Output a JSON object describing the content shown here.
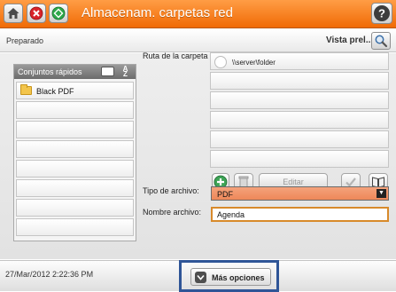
{
  "header": {
    "title": "Almacenam. carpetas red",
    "icons": {
      "home": "home-icon",
      "stop": "stop-icon",
      "start": "start-icon",
      "help": "help-icon"
    },
    "accent_color": "#f07a1a"
  },
  "status": {
    "text": "Preparado",
    "preview_label": "Vista prel..."
  },
  "quick_sets": {
    "title": "Conjuntos rápidos",
    "sort_top": "A",
    "sort_bottom": "Z",
    "items": [
      "Black PDF"
    ]
  },
  "folder_path": {
    "label": "Ruta de la carpeta",
    "items": [
      "\\\\server\\folder"
    ]
  },
  "toolbar": {
    "edit_label": "Editar"
  },
  "file_type": {
    "label": "Tipo de archivo:",
    "value": "PDF"
  },
  "file_name": {
    "label": "Nombre archivo:",
    "value": "Agenda"
  },
  "footer": {
    "datetime": "27/Mar/2012 2:22:36 PM",
    "more_options": "Más opciones"
  }
}
